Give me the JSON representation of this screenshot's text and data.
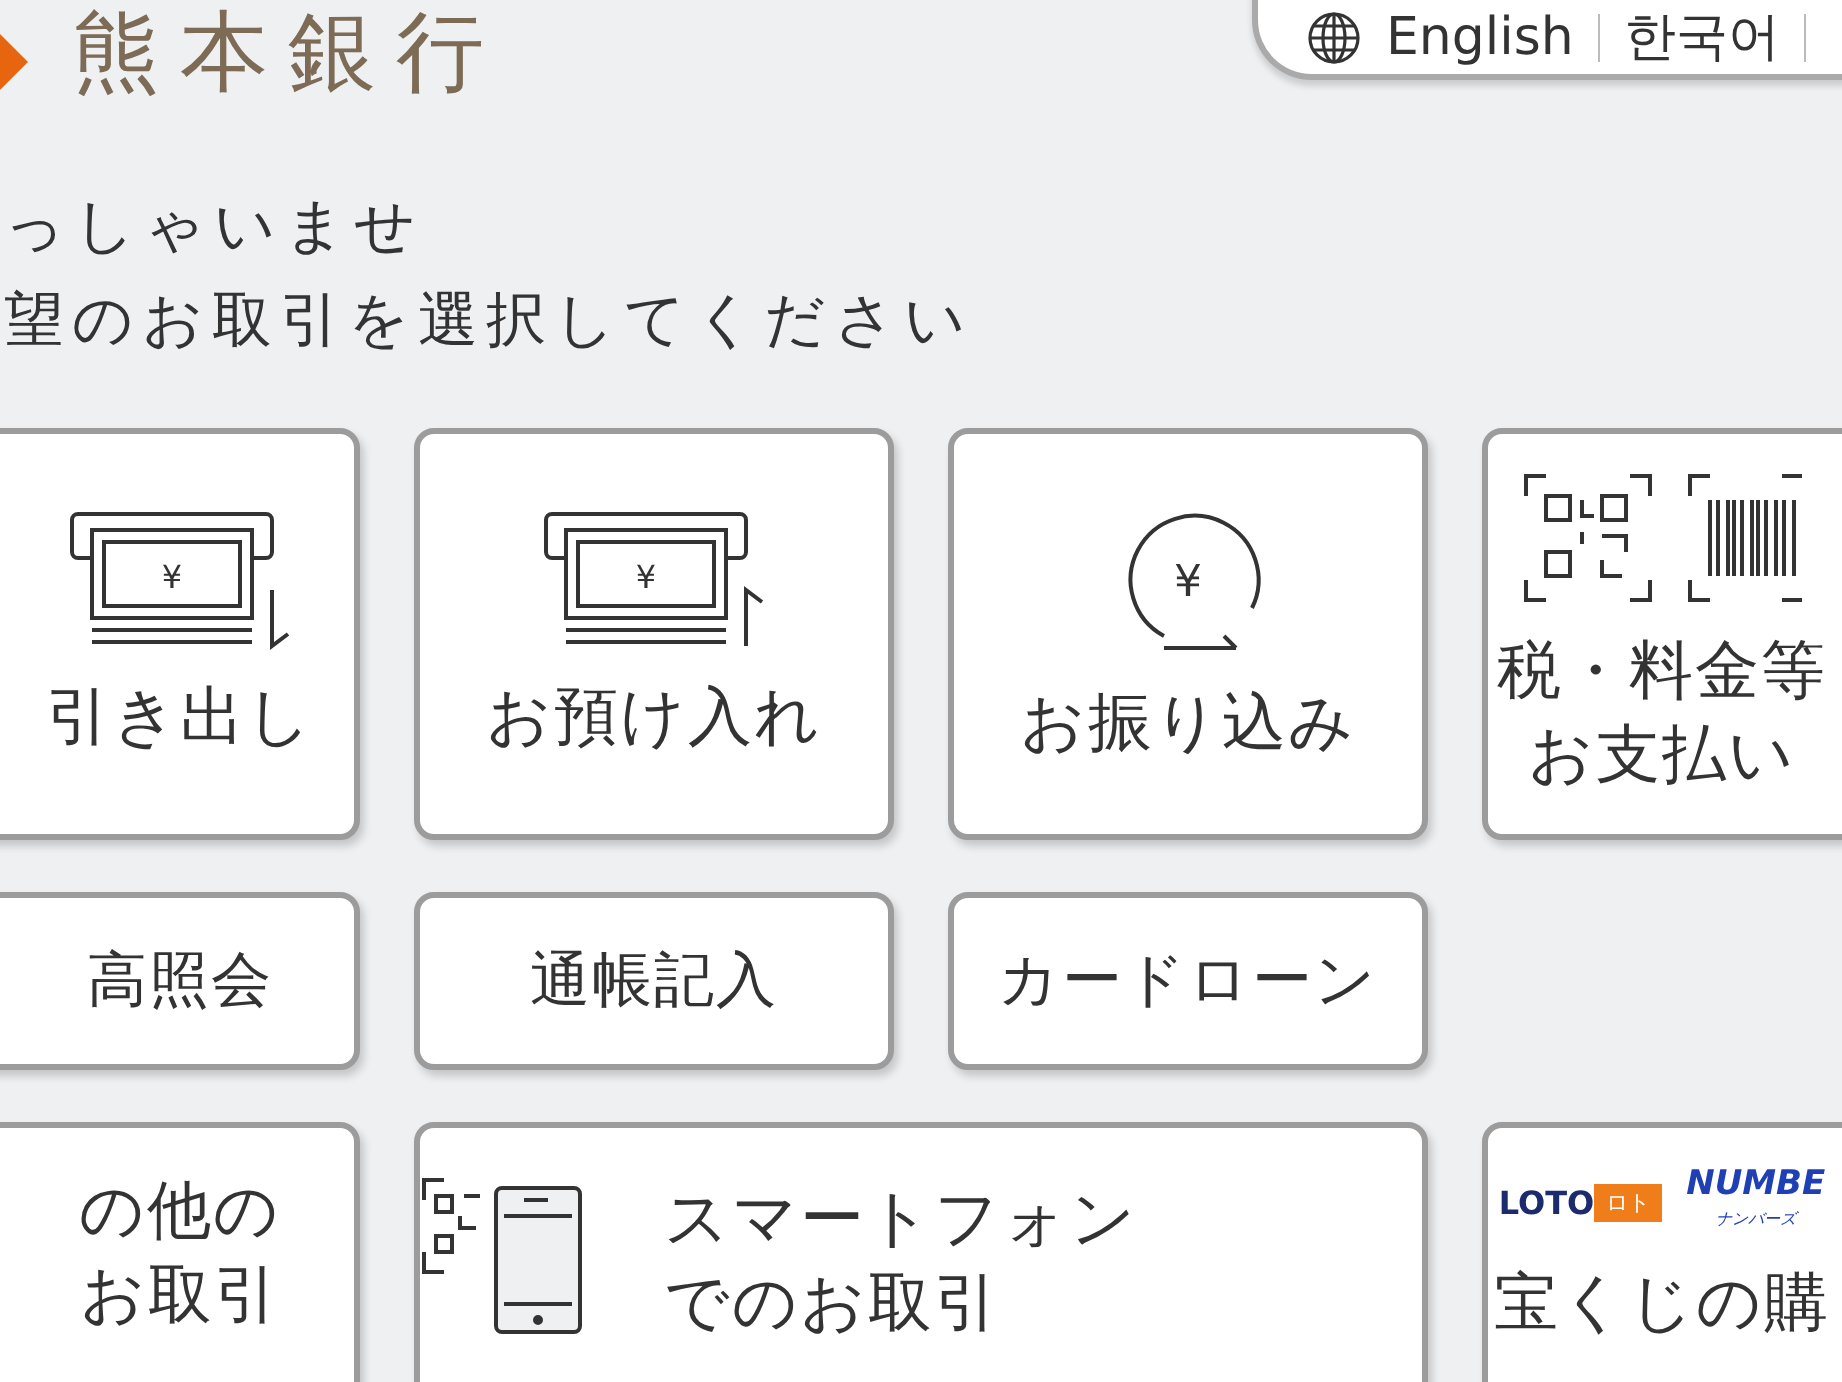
{
  "header": {
    "logo_text": "熊本銀行",
    "languages": [
      {
        "label": "English"
      },
      {
        "label": "한국어"
      }
    ]
  },
  "greeting": [
    "っしゃいませ",
    "望のお取引を選択してください"
  ],
  "menu_rows": [
    [
      {
        "kind": "cash-out",
        "symbol": "¥",
        "lines": [
          "引き出し"
        ]
      },
      {
        "kind": "cash-in",
        "symbol": "¥",
        "lines": [
          "お預け入れ"
        ]
      },
      {
        "kind": "transfer",
        "symbol": "¥",
        "lines": [
          "お振り込み"
        ]
      },
      {
        "kind": "payment",
        "lines": [
          "税・料金等",
          "お支払い"
        ]
      }
    ],
    [
      {
        "kind": "plain",
        "lines": [
          "高照会"
        ]
      },
      {
        "kind": "plain",
        "lines": [
          "通帳記入"
        ]
      },
      {
        "kind": "plain",
        "lines": [
          "カードローン"
        ]
      }
    ],
    [
      {
        "kind": "plain",
        "lines": [
          "の他の",
          "お取引"
        ]
      },
      {
        "kind": "phone",
        "lines": [
          "スマートフォン",
          "でのお取引"
        ]
      },
      {
        "kind": "lottery",
        "logos": [
          "LOTO",
          "ロト",
          "NUMBE",
          "ナンバーズ"
        ],
        "lines": [
          "宝くじの購"
        ]
      }
    ]
  ]
}
